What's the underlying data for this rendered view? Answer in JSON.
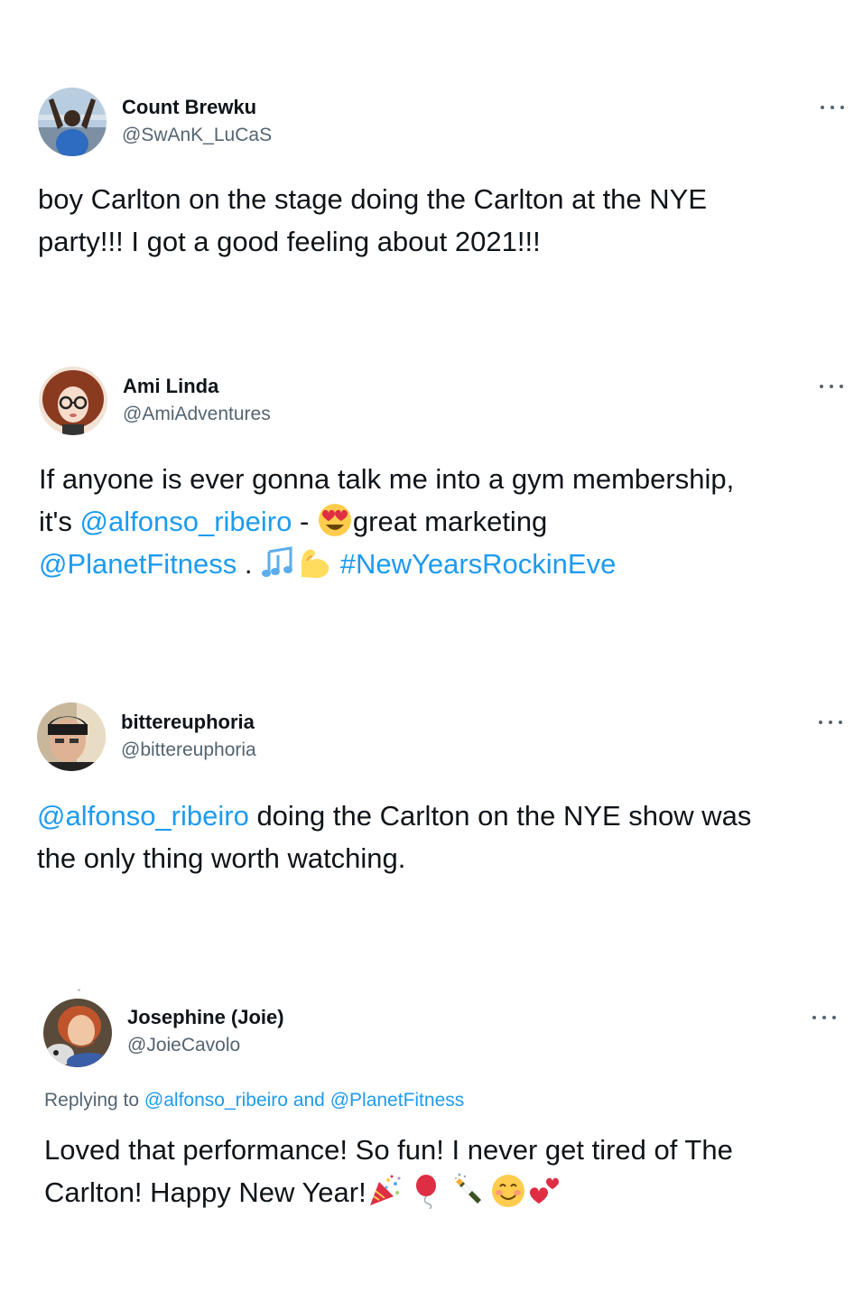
{
  "tweets": [
    {
      "name": "Count Brewku",
      "handle": "@SwAnK_LuCaS",
      "line1": "boy Carlton on the stage doing the Carlton at the NYE",
      "line2": "party!!! I got a good feeling about 2021!!!"
    },
    {
      "name": "Ami Linda",
      "handle": "@AmiAdventures",
      "line1_text": "If anyone is ever gonna talk me into a gym membership,",
      "line2_pre": "it's ",
      "line2_mention": "@alfonso_ribeiro",
      "line2_sep": " - ",
      "line2_post": "great marketing",
      "line3_mention": "@PlanetFitness",
      "line3_sep": " . ",
      "line3_hashtag": "#NewYearsRockinEve",
      "emojis": [
        "heart-eyes-emoji",
        "music-notes-emoji",
        "flexed-biceps-emoji"
      ]
    },
    {
      "name": "bittereuphoria",
      "handle": "@bittereuphoria",
      "line1_mention": "@alfonso_ribeiro",
      "line1_post": " doing the Carlton on the NYE show was",
      "line2": "the only thing worth watching."
    },
    {
      "name": "Josephine (Joie)",
      "handle": "@JoieCavolo",
      "replying_prefix": "Replying to ",
      "replying_user1": "@alfonso_ribeiro",
      "replying_and": " and ",
      "replying_user2": "@PlanetFitness",
      "line1": "Loved that performance!  So fun!  I never get tired of The",
      "line2": "Carlton!  Happy New Year!",
      "emojis": [
        "party-popper-emoji",
        "balloon-emoji",
        "champagne-emoji",
        "smiling-emoji",
        "two-hearts-emoji"
      ]
    }
  ],
  "colors": {
    "link": "#1d9bf0",
    "text": "#0f1419",
    "secondary": "#536471"
  }
}
